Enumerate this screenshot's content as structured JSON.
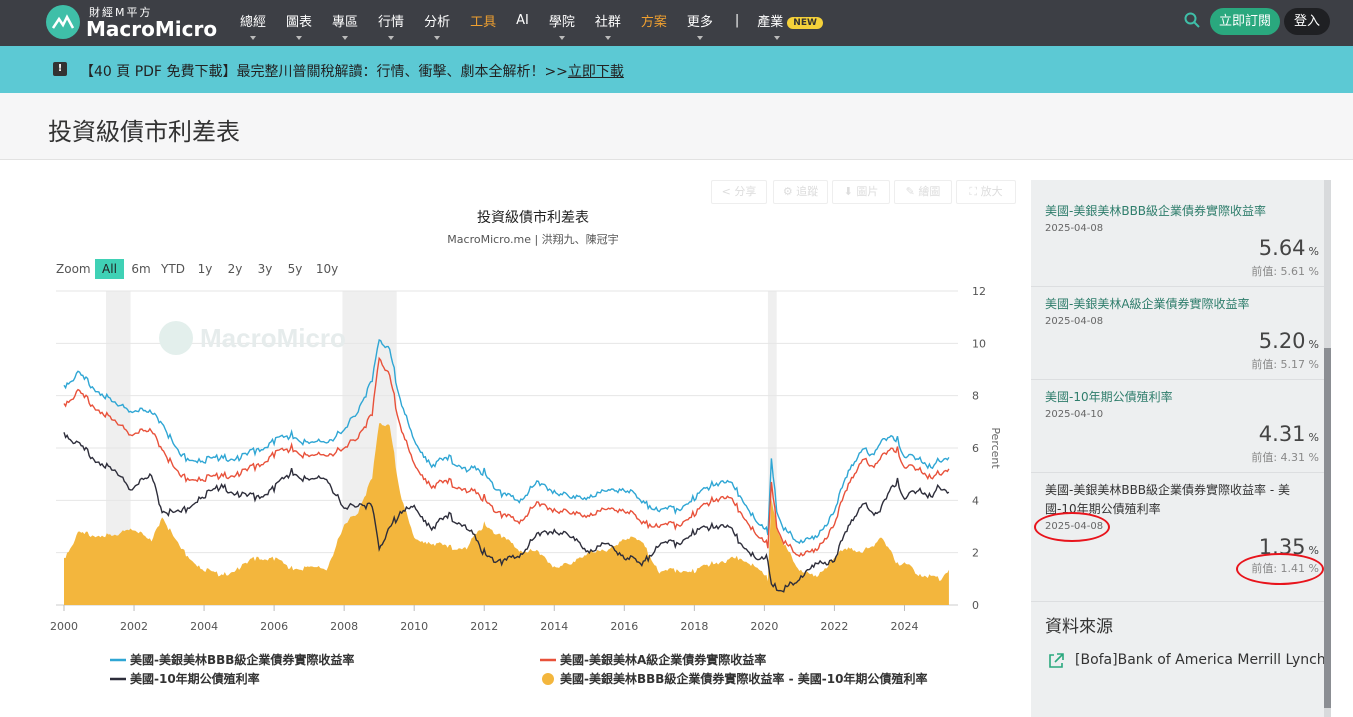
{
  "header": {
    "logo_subtitle": "財經M平方",
    "logo_name": "MacroMicro",
    "nav": [
      "總經",
      "圖表",
      "專區",
      "行情",
      "分析",
      "工具",
      "AI",
      "學院",
      "社群",
      "方案",
      "更多"
    ],
    "nav_highlight": [
      "工具",
      "方案"
    ],
    "industry_label": "產業",
    "new_badge": "NEW",
    "subscribe_label": "立即訂閱",
    "login_label": "登入",
    "accent_color": "#2aa87e"
  },
  "banner": {
    "text": "【40 頁 PDF 免費下載】最完整川普關稅解讀：行情、衝擊、劇本全解析！>>",
    "link": "立即下載",
    "icon": "exclamation-icon"
  },
  "page_title": "投資級債市利差表",
  "toolbar": {
    "share": "分享",
    "follow": "追蹤",
    "image": "圖片",
    "draw": "繪圖",
    "enlarge": "放大"
  },
  "chart": {
    "title": "投資級債市利差表",
    "subtitle": "MacroMicro.me | 洪翔九、陳冠宇",
    "watermark": "MacroMicro",
    "zoom_label": "Zoom",
    "zoom_options": [
      "All",
      "6m",
      "YTD",
      "1y",
      "2y",
      "3y",
      "5y",
      "10y"
    ],
    "zoom_selected": "All",
    "y_axis_label": "Percent"
  },
  "chart_data": {
    "type": "line",
    "x_ticks": [
      "2000",
      "2002",
      "2004",
      "2006",
      "2008",
      "2010",
      "2012",
      "2014",
      "2016",
      "2018",
      "2020",
      "2022",
      "2024"
    ],
    "y_ticks": [
      "0",
      "2",
      "4",
      "6",
      "8",
      "10",
      "12"
    ],
    "xlim": [
      2000,
      2025.3
    ],
    "ylim": [
      0,
      12
    ],
    "shaded_periods": [
      [
        2001.2,
        2001.9
      ],
      [
        2007.95,
        2009.5
      ],
      [
        2020.1,
        2020.35
      ]
    ],
    "series": [
      {
        "name": "美國-美銀美林BBB級企業債券實際收益率",
        "color": "#2fa6d4",
        "type": "line",
        "x": [
          2000,
          2000.4,
          2000.9,
          2001.5,
          2001.9,
          2002.5,
          2002.8,
          2003.3,
          2003.9,
          2004.5,
          2005,
          2005.5,
          2006,
          2006.5,
          2007,
          2007.5,
          2008,
          2008.4,
          2008.8,
          2009,
          2009.3,
          2009.6,
          2010,
          2010.5,
          2011,
          2011.5,
          2012,
          2012.5,
          2013,
          2013.5,
          2014,
          2014.5,
          2015,
          2015.5,
          2016,
          2016.5,
          2017,
          2017.5,
          2018,
          2018.5,
          2018.9,
          2019.3,
          2019.8,
          2020.1,
          2020.2,
          2020.35,
          2020.6,
          2021,
          2021.5,
          2022,
          2022.4,
          2022.8,
          2023,
          2023.3,
          2023.8,
          2024,
          2024.4,
          2024.8,
          2025,
          2025.27
        ],
        "values": [
          8.4,
          8.8,
          8.3,
          7.6,
          7.5,
          7.3,
          7.0,
          5.7,
          5.5,
          5.6,
          5.6,
          5.9,
          6.3,
          6.5,
          6.1,
          6.3,
          6.6,
          7.5,
          8.5,
          10.2,
          9.7,
          7.9,
          6.2,
          5.4,
          5.6,
          5.2,
          5.1,
          4.2,
          4.0,
          4.6,
          4.4,
          4.0,
          4.2,
          4.3,
          4.5,
          3.9,
          3.7,
          3.6,
          4.1,
          4.6,
          4.8,
          4.2,
          3.1,
          2.8,
          5.5,
          3.7,
          2.8,
          2.5,
          2.5,
          3.7,
          5.0,
          6.1,
          5.6,
          6.2,
          6.4,
          5.6,
          5.7,
          5.2,
          5.6,
          5.64
        ]
      },
      {
        "name": "美國-美銀美林A級企業債券實際收益率",
        "color": "#e8513a",
        "type": "line",
        "x": [
          2000,
          2000.4,
          2000.9,
          2001.5,
          2001.9,
          2002.5,
          2002.8,
          2003.3,
          2003.9,
          2004.5,
          2005,
          2005.5,
          2006,
          2006.5,
          2007,
          2007.5,
          2008,
          2008.4,
          2008.8,
          2009,
          2009.3,
          2009.6,
          2010,
          2010.5,
          2011,
          2011.5,
          2012,
          2012.5,
          2013,
          2013.5,
          2014,
          2014.5,
          2015,
          2015.5,
          2016,
          2016.5,
          2017,
          2017.5,
          2018,
          2018.5,
          2018.9,
          2019.3,
          2019.8,
          2020.1,
          2020.2,
          2020.35,
          2020.6,
          2021,
          2021.5,
          2022,
          2022.4,
          2022.8,
          2023,
          2023.3,
          2023.8,
          2024,
          2024.4,
          2024.8,
          2025,
          2025.27
        ],
        "values": [
          7.7,
          8.1,
          7.6,
          6.9,
          6.6,
          6.6,
          6.0,
          4.9,
          4.8,
          4.9,
          5.0,
          5.3,
          5.8,
          6.0,
          5.6,
          5.8,
          5.9,
          6.5,
          7.2,
          9.5,
          8.7,
          6.9,
          5.3,
          4.6,
          4.7,
          4.4,
          4.1,
          3.4,
          3.2,
          3.8,
          3.7,
          3.4,
          3.5,
          3.6,
          3.7,
          3.1,
          3.1,
          3.0,
          3.5,
          4.0,
          4.2,
          3.6,
          2.6,
          2.3,
          4.6,
          3.1,
          2.3,
          2.0,
          2.0,
          3.2,
          4.5,
          5.7,
          5.2,
          5.6,
          6.0,
          5.2,
          5.3,
          4.8,
          5.1,
          5.2
        ]
      },
      {
        "name": "美國-10年期公債殖利率",
        "color": "#2d2d3a",
        "type": "line",
        "x": [
          2000,
          2000.4,
          2000.9,
          2001.5,
          2001.9,
          2002.5,
          2002.8,
          2003.3,
          2003.9,
          2004.5,
          2005,
          2005.5,
          2006,
          2006.5,
          2007,
          2007.5,
          2008,
          2008.4,
          2008.8,
          2009,
          2009.3,
          2009.6,
          2010,
          2010.5,
          2011,
          2011.5,
          2012,
          2012.5,
          2013,
          2013.5,
          2014,
          2014.5,
          2015,
          2015.5,
          2016,
          2016.5,
          2017,
          2017.5,
          2018,
          2018.5,
          2018.9,
          2019.3,
          2019.8,
          2020.1,
          2020.2,
          2020.35,
          2020.6,
          2021,
          2021.5,
          2022,
          2022.4,
          2022.8,
          2023,
          2023.3,
          2023.8,
          2024,
          2024.4,
          2024.8,
          2025,
          2025.27
        ],
        "values": [
          6.6,
          6.1,
          5.6,
          5.0,
          4.5,
          4.9,
          3.6,
          3.5,
          4.1,
          4.5,
          4.2,
          4.1,
          4.5,
          5.1,
          4.7,
          4.9,
          3.6,
          3.9,
          3.7,
          2.2,
          2.9,
          3.6,
          3.7,
          3.0,
          3.4,
          3.0,
          2.0,
          1.6,
          1.9,
          2.6,
          2.9,
          2.5,
          2.1,
          2.3,
          1.9,
          1.5,
          2.4,
          2.3,
          2.8,
          3.0,
          3.1,
          2.4,
          1.7,
          1.8,
          0.7,
          0.7,
          0.6,
          1.1,
          1.5,
          1.8,
          2.9,
          4.0,
          3.5,
          3.6,
          4.8,
          4.0,
          4.5,
          4.1,
          4.6,
          4.31
        ]
      },
      {
        "name": "美國-美銀美林BBB級企業債券實際收益率 - 美國-10年期公債殖利率",
        "color": "#f3b63d",
        "type": "area",
        "x": [
          2000,
          2000.4,
          2000.9,
          2001.5,
          2001.9,
          2002.5,
          2002.8,
          2003.3,
          2003.9,
          2004.5,
          2005,
          2005.5,
          2006,
          2006.5,
          2007,
          2007.5,
          2008,
          2008.4,
          2008.8,
          2009,
          2009.3,
          2009.6,
          2010,
          2010.5,
          2011,
          2011.5,
          2012,
          2012.5,
          2013,
          2013.5,
          2014,
          2014.5,
          2015,
          2015.5,
          2016,
          2016.5,
          2017,
          2017.5,
          2018,
          2018.5,
          2018.9,
          2019.3,
          2019.8,
          2020.1,
          2020.2,
          2020.35,
          2020.6,
          2021,
          2021.5,
          2022,
          2022.4,
          2022.8,
          2023,
          2023.3,
          2023.8,
          2024,
          2024.4,
          2024.8,
          2025,
          2025.27
        ],
        "values": [
          1.8,
          2.7,
          2.7,
          2.6,
          3.0,
          2.4,
          3.4,
          2.2,
          1.4,
          1.1,
          1.4,
          1.8,
          1.8,
          1.4,
          1.4,
          1.4,
          3.0,
          3.6,
          4.8,
          7.0,
          6.8,
          4.3,
          2.5,
          2.4,
          2.2,
          2.2,
          3.1,
          2.6,
          2.1,
          2.0,
          1.5,
          1.5,
          2.1,
          2.0,
          2.6,
          2.4,
          1.3,
          1.3,
          1.3,
          1.6,
          1.7,
          1.8,
          1.4,
          1.0,
          4.0,
          3.0,
          2.2,
          1.4,
          1.0,
          1.9,
          2.1,
          2.1,
          2.1,
          2.6,
          1.6,
          1.6,
          1.2,
          1.1,
          1.0,
          1.35
        ]
      }
    ]
  },
  "sidebar": {
    "items": [
      {
        "name": "美國-美銀美林BBB級企業債券實際收益率",
        "date": "2025-04-08",
        "value": "5.64",
        "unit": "%",
        "prev": "前值: 5.61 %"
      },
      {
        "name": "美國-美銀美林A級企業債券實際收益率",
        "date": "2025-04-08",
        "value": "5.20",
        "unit": "%",
        "prev": "前值: 5.17 %"
      },
      {
        "name": "美國-10年期公債殖利率",
        "date": "2025-04-10",
        "value": "4.31",
        "unit": "%",
        "prev": "前值: 4.31 %"
      },
      {
        "name": "美國-美銀美林BBB級企業債券實際收益率 - 美國-10年期公債殖利率",
        "date": "2025-04-08",
        "value": "1.35",
        "unit": "%",
        "prev": "前值: 1.41 %"
      }
    ],
    "source_title": "資料來源",
    "source_link": "[Bofa]Bank of America Merrill Lynch"
  }
}
